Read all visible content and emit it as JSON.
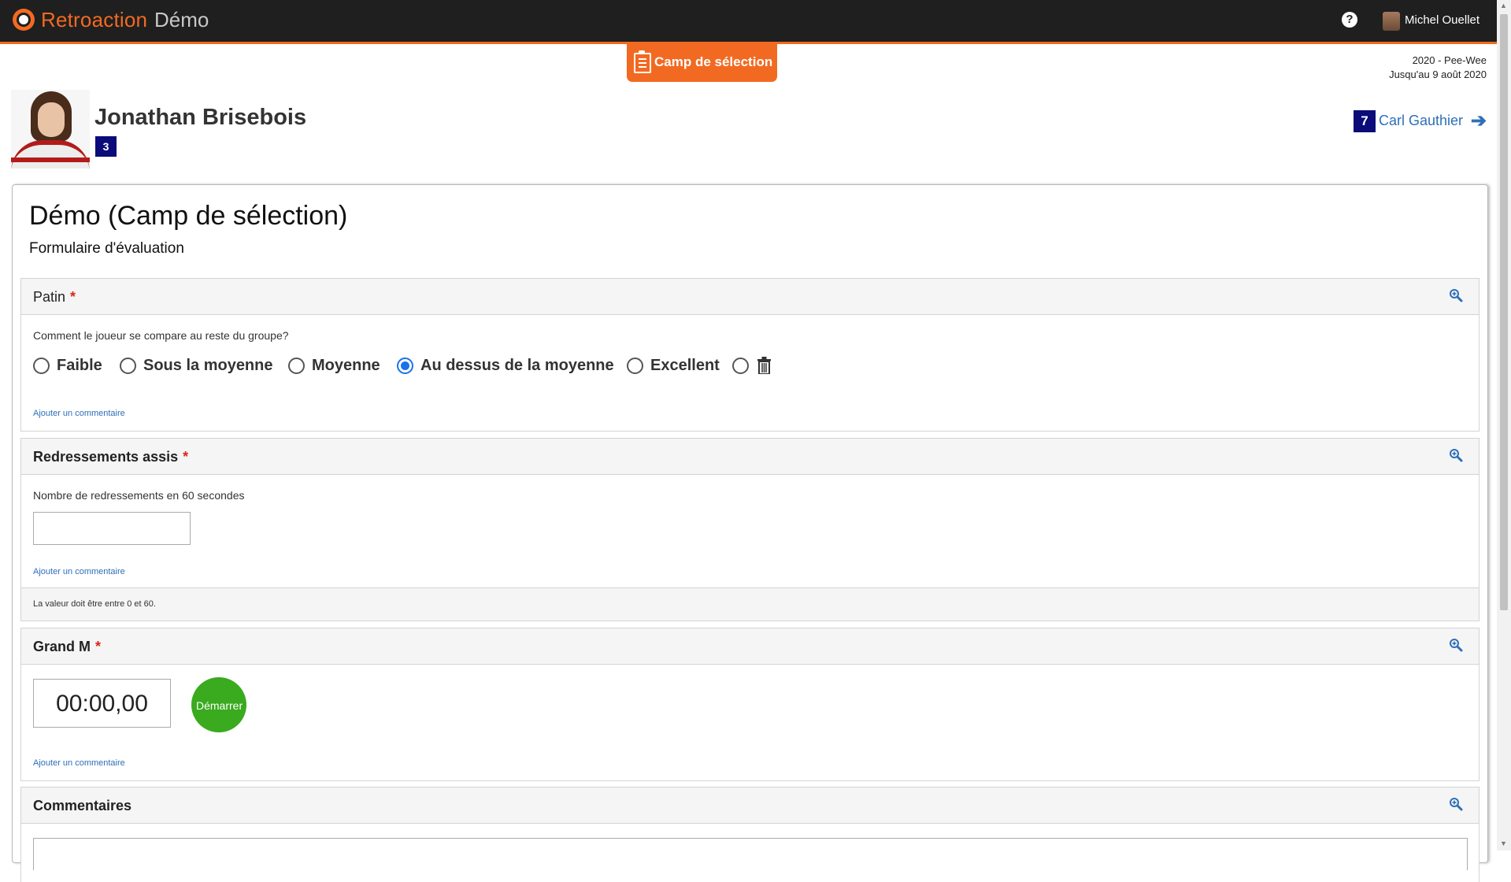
{
  "app": {
    "brand": "Retroaction",
    "sub": "Démo"
  },
  "topbar": {
    "help_icon": "question-circle-icon",
    "user_name": "Michel Ouellet"
  },
  "mode_badge": {
    "label": "Camp de sélection",
    "icon": "clipboard-icon"
  },
  "season": {
    "line1": "2020 - Pee-Wee",
    "line2": "Jusqu'au 9 août 2020"
  },
  "player": {
    "name": "Jonathan Brisebois",
    "number": "3"
  },
  "next_player": {
    "number": "7",
    "name": "Carl Gauthier",
    "arrow": "➔"
  },
  "form": {
    "title": "Démo (Camp de sélection)",
    "subtitle": "Formulaire d'évaluation"
  },
  "sections": {
    "patin": {
      "title": "Patin",
      "required": "*",
      "question": "Comment le joueur se compare au reste du groupe?",
      "options": [
        "Faible",
        "Sous la moyenne",
        "Moyenne",
        "Au dessus de la moyenne",
        "Excellent"
      ],
      "selected": "Au dessus de la moyenne",
      "add_comment": "Ajouter un commentaire"
    },
    "redressements": {
      "title": "Redressements assis",
      "required": "*",
      "question": "Nombre de redressements en 60 secondes",
      "value": "",
      "add_comment": "Ajouter un commentaire",
      "validation": "La valeur doit être entre 0 et 60."
    },
    "grand_m": {
      "title": "Grand M",
      "required": "*",
      "timer": "00:00,00",
      "start_label": "Démarrer",
      "add_comment": "Ajouter un commentaire"
    },
    "commentaires": {
      "title": "Commentaires",
      "value": ""
    }
  },
  "colors": {
    "accent": "#f26a21",
    "dark": "#1f1f1f",
    "link": "#2e6fb8",
    "badge": "#0b0b7a",
    "success": "#3aaa1f",
    "radio": "#1a73e8"
  }
}
